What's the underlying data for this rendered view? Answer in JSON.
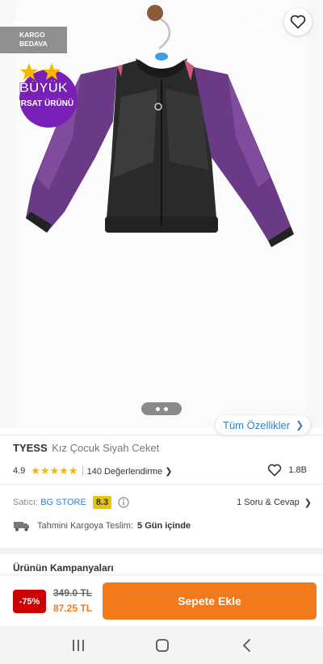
{
  "badges": {
    "kargo_line1": "KARGO",
    "kargo_line2": "BEDAVA",
    "firsat_line1": "BÜYÜK",
    "firsat_line2": "FIRSAT ÜRÜNÜ"
  },
  "gallery": {
    "pages": 2,
    "current_page": 1,
    "features_label": "Tüm Özellikler"
  },
  "product": {
    "brand": "TYESS",
    "name": "Kız Çocuk Siyah Ceket",
    "rating": "4.9",
    "stars": "★★★★★",
    "reviews": "140 Değerlendirme",
    "favorites": "1.8B"
  },
  "seller": {
    "label": "Satıcı:",
    "name": "BG STORE",
    "score": "8.3",
    "qa": "1 Soru & Cevap"
  },
  "shipping": {
    "label": "Tahmini Kargoya Teslim:",
    "value": "5 Gün içinde"
  },
  "campaigns": {
    "title": "Ürünün Kampanyaları"
  },
  "purchase": {
    "discount": "-75%",
    "old_price": "349.0 TL",
    "new_price": "87.25 TL",
    "add_label": "Sepete Ekle"
  },
  "colors": {
    "accent": "#f27a1a",
    "link": "#2f7fcf",
    "discount": "#cc0000",
    "score": "#e8c30c"
  }
}
